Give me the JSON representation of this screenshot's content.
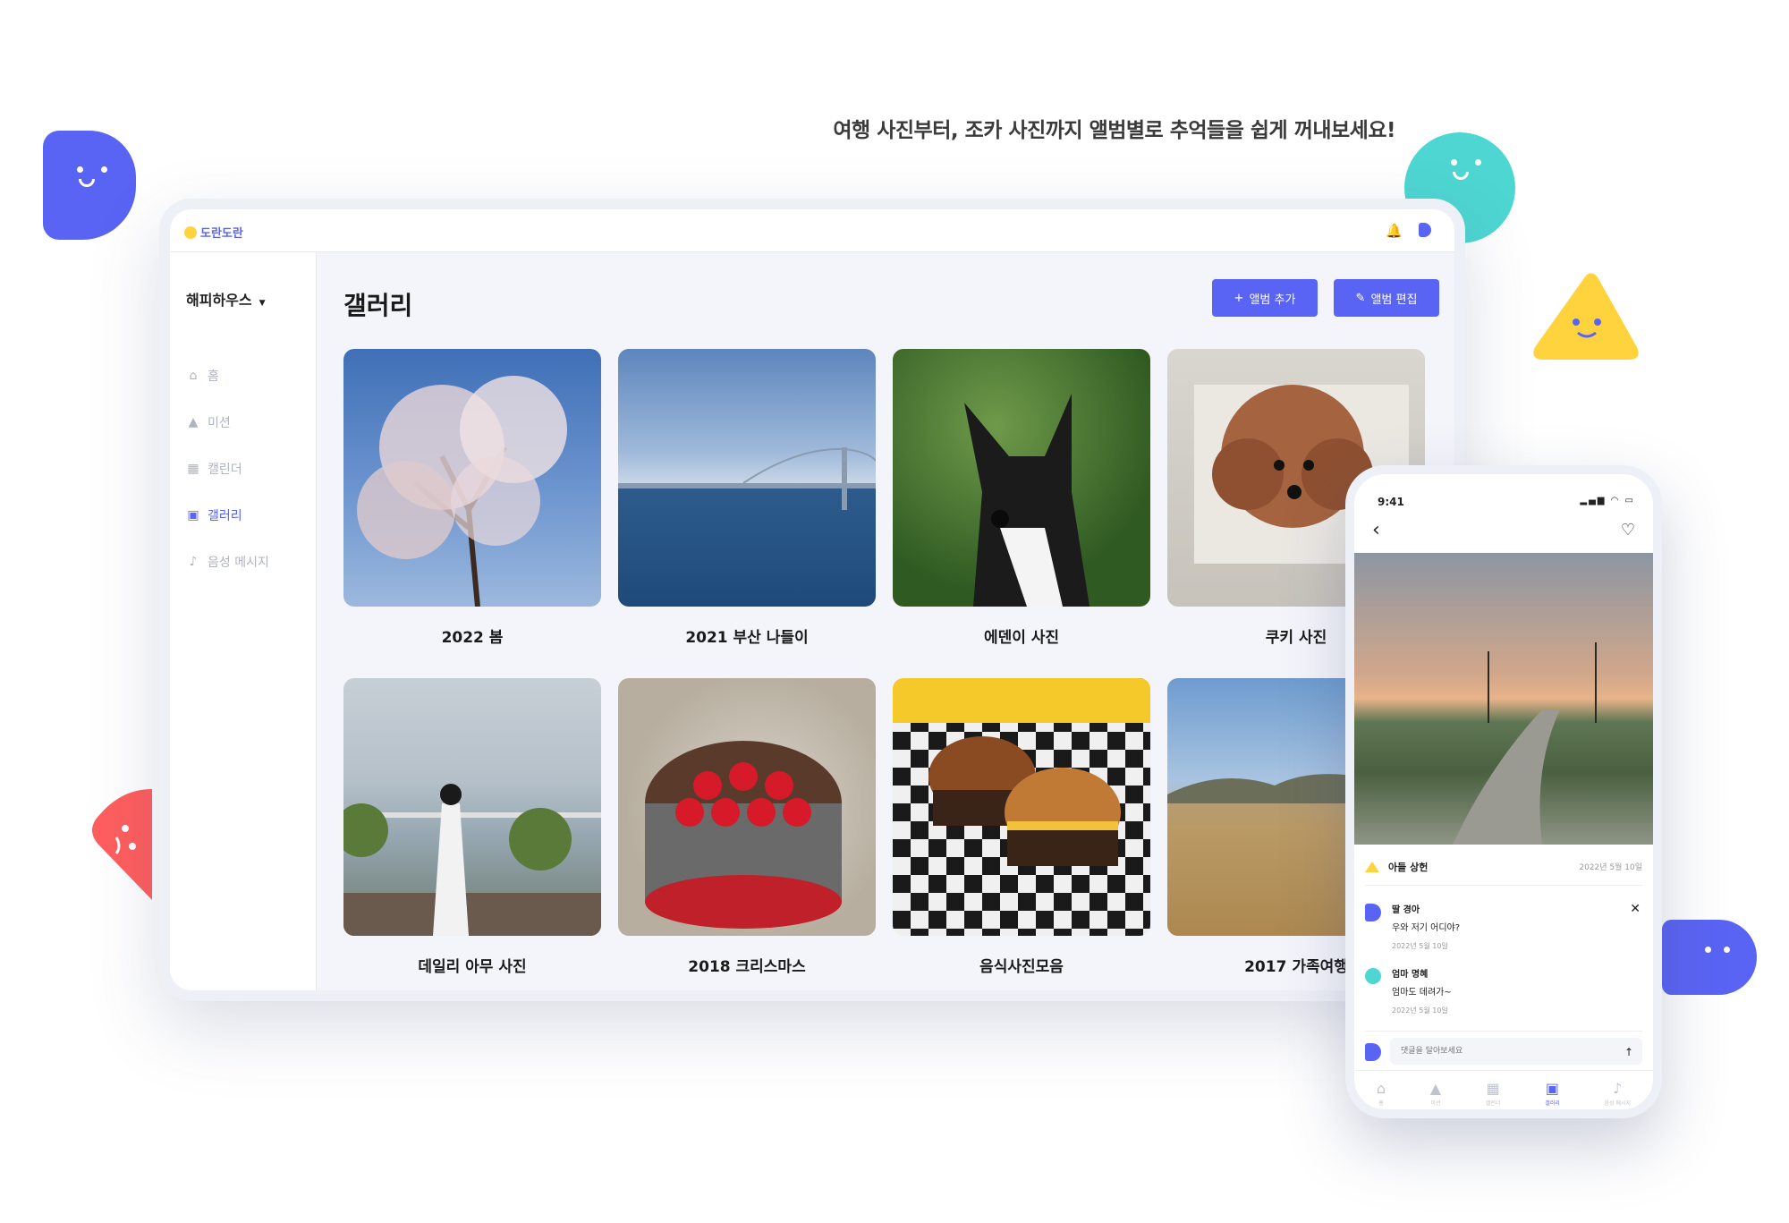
{
  "tagline": "여행 사진부터, 조카 사진까지 앨범별로 추억들을 쉽게 꺼내보세요!",
  "app": {
    "logo": "도란도란"
  },
  "sidebar": {
    "family": "해피하우스",
    "items": [
      {
        "icon": "home-icon",
        "label": "홈"
      },
      {
        "icon": "mission-icon",
        "label": "미션"
      },
      {
        "icon": "calendar-icon",
        "label": "캘린더"
      },
      {
        "icon": "gallery-icon",
        "label": "갤러리"
      },
      {
        "icon": "mic-icon",
        "label": "음성 메시지"
      }
    ]
  },
  "main": {
    "title": "갤러리",
    "add_label": "앨범 추가",
    "edit_label": "앨범 편집",
    "albums": [
      {
        "label": "2022 봄"
      },
      {
        "label": "2021 부산 나들이"
      },
      {
        "label": "에덴이 사진"
      },
      {
        "label": "쿠키 사진"
      },
      {
        "label": "데일리 아무 사진"
      },
      {
        "label": "2018 크리스마스"
      },
      {
        "label": "음식사진모음"
      },
      {
        "label": "2017 가족여행"
      }
    ]
  },
  "phone": {
    "time": "9:41",
    "author": "아들 상헌",
    "post_date": "2022년 5월 10일",
    "comments": [
      {
        "name": "딸 경아",
        "text": "우와 저기 어디야?",
        "date": "2022년 5월 10일"
      },
      {
        "name": "엄마 명혜",
        "text": "엄마도 데려가~",
        "date": "2022년 5월 10일"
      }
    ],
    "input_placeholder": "댓글을 달아보세요",
    "tabs": [
      "홈",
      "미션",
      "캘린더",
      "갤러리",
      "음성 메시지"
    ]
  },
  "colors": {
    "accent": "#5a64f4",
    "teal": "#4ed6d2",
    "yellow": "#ffd33d",
    "red": "#ff5e5e"
  }
}
